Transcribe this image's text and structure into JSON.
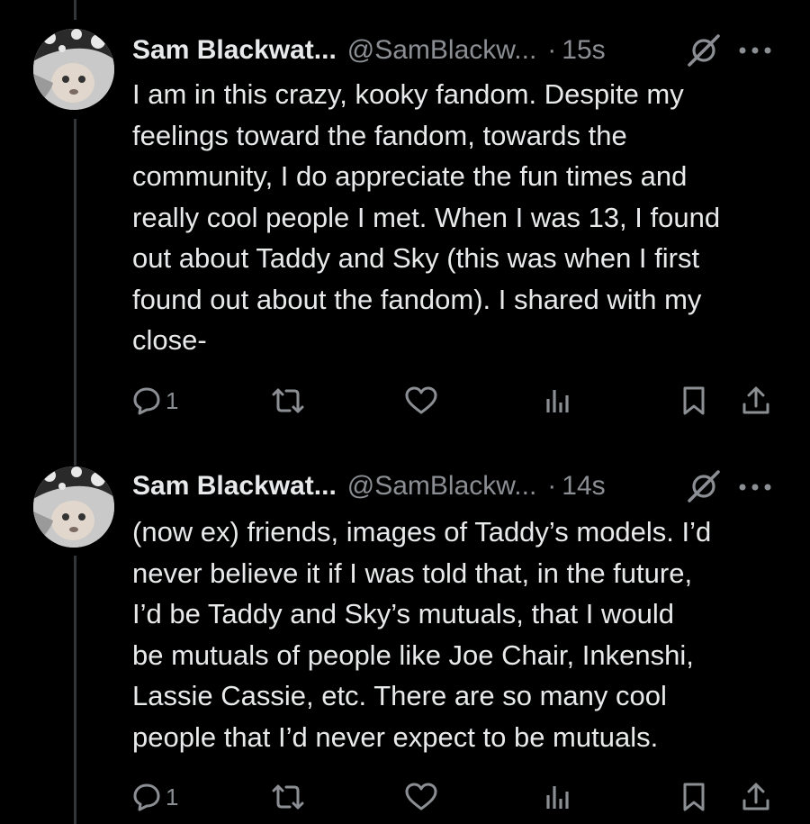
{
  "tweets": [
    {
      "author_name": "Sam Blackwat...",
      "handle": "@SamBlackw...",
      "separator": "·",
      "time": "15s",
      "text_lines": [
        "I am in this crazy, kooky fandom. Despite my",
        "feelings toward the fandom, towards the",
        "community, I do appreciate the fun times and",
        "really cool people I met. When I was 13, I found",
        "out about Taddy and Sky (this was when I first",
        "found out about the fandom). I shared with my",
        "close-"
      ],
      "reply_count": "1"
    },
    {
      "author_name": "Sam Blackwat...",
      "handle": "@SamBlackw...",
      "separator": "·",
      "time": "14s",
      "text_lines": [
        "(now ex) friends, images of Taddy’s models. I’d",
        "never believe it if I was told that, in the future,",
        "I’d be Taddy and Sky’s mutuals, that I would",
        "be mutuals of people like Joe Chair, Inkenshi,",
        "Lassie Cassie, etc. There are so many cool",
        "people that I’d never expect to be mutuals."
      ],
      "reply_count": "1"
    }
  ],
  "icons": [
    "avatar-image",
    "grok-icon",
    "more-icon",
    "reply-icon",
    "retweet-icon",
    "like-icon",
    "views-icon",
    "bookmark-icon",
    "share-icon"
  ],
  "colors": {
    "background": "#000000",
    "text": "#e7e9ea",
    "secondary": "#8b8f94",
    "thread_line": "#333639"
  }
}
